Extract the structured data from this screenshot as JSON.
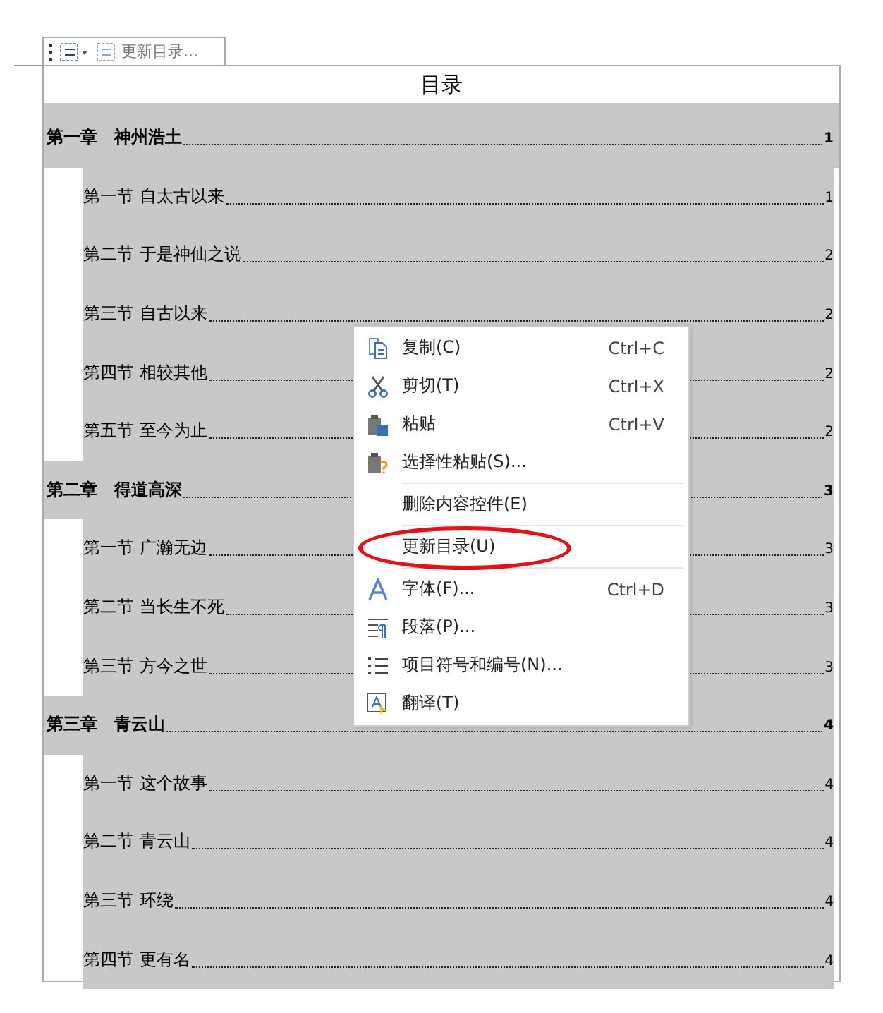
{
  "toolbar": {
    "update_label": "更新目录..."
  },
  "toc": {
    "title": "目录",
    "entries": [
      {
        "kind": "chapter",
        "label": "第一章　神州浩土",
        "page": "1"
      },
      {
        "kind": "section",
        "label": "第一节 自太古以来",
        "page": "1"
      },
      {
        "kind": "section",
        "label": "第二节 于是神仙之说",
        "page": "2"
      },
      {
        "kind": "section",
        "label": "第三节 自古以来",
        "page": "2"
      },
      {
        "kind": "section",
        "label": "第四节 相较其他",
        "page": "2"
      },
      {
        "kind": "section",
        "label": "第五节 至今为止",
        "page": "2"
      },
      {
        "kind": "chapter",
        "label": "第二章　得道高深",
        "page": "3"
      },
      {
        "kind": "section",
        "label": "第一节 广瀚无边",
        "page": "3"
      },
      {
        "kind": "section",
        "label": "第二节 当长生不死",
        "page": "3"
      },
      {
        "kind": "section",
        "label": "第三节 方今之世",
        "page": "3"
      },
      {
        "kind": "chapter",
        "label": "第三章　青云山",
        "page": "4"
      },
      {
        "kind": "section",
        "label": "第一节 这个故事",
        "page": "4"
      },
      {
        "kind": "section",
        "label": "第二节 青云山",
        "page": "4"
      },
      {
        "kind": "section",
        "label": "第三节 环绕",
        "page": "4"
      },
      {
        "kind": "section",
        "label": "第四节 更有名",
        "page": "4"
      }
    ]
  },
  "context_menu": {
    "groups": [
      [
        {
          "label": "复制(C)",
          "shortcut": "Ctrl+C",
          "circled": false
        },
        {
          "label": "剪切(T)",
          "shortcut": "Ctrl+X",
          "circled": false
        },
        {
          "label": "粘贴",
          "shortcut": "Ctrl+V",
          "circled": false
        },
        {
          "label": "选择性粘贴(S)...",
          "circled": false
        }
      ],
      [
        {
          "label": "删除内容控件(E)",
          "circled": false
        }
      ],
      [
        {
          "label": "更新目录(U)",
          "circled": true
        }
      ],
      [
        {
          "label": "字体(F)...",
          "shortcut": "Ctrl+D",
          "circled": false
        },
        {
          "label": "段落(P)...",
          "circled": false
        },
        {
          "label": "项目符号和编号(N)...",
          "circled": false
        },
        {
          "label": "翻译(T)",
          "circled": false
        }
      ]
    ]
  }
}
